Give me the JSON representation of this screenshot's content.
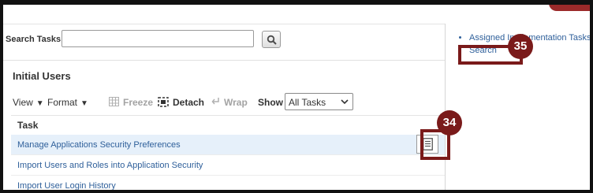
{
  "search": {
    "label": "Search Tasks",
    "value": ""
  },
  "section": {
    "title": "Initial Users"
  },
  "toolbar": {
    "view": "View",
    "format": "Format",
    "freeze": "Freeze",
    "detach": "Detach",
    "wrap": "Wrap",
    "show_label": "Show",
    "show_value": "All Tasks"
  },
  "table": {
    "header": "Task",
    "rows": [
      "Manage Applications Security Preferences",
      "Import Users and Roles into Application Security",
      "Import User Login History"
    ]
  },
  "side_links": [
    "Assigned Implementation Tasks",
    "Search"
  ],
  "callouts": {
    "step_34": "34",
    "step_35": "35"
  },
  "colors": {
    "callout": "#7a1a1a",
    "link": "#2e5f9a",
    "selected_row": "#e6f0fa"
  }
}
